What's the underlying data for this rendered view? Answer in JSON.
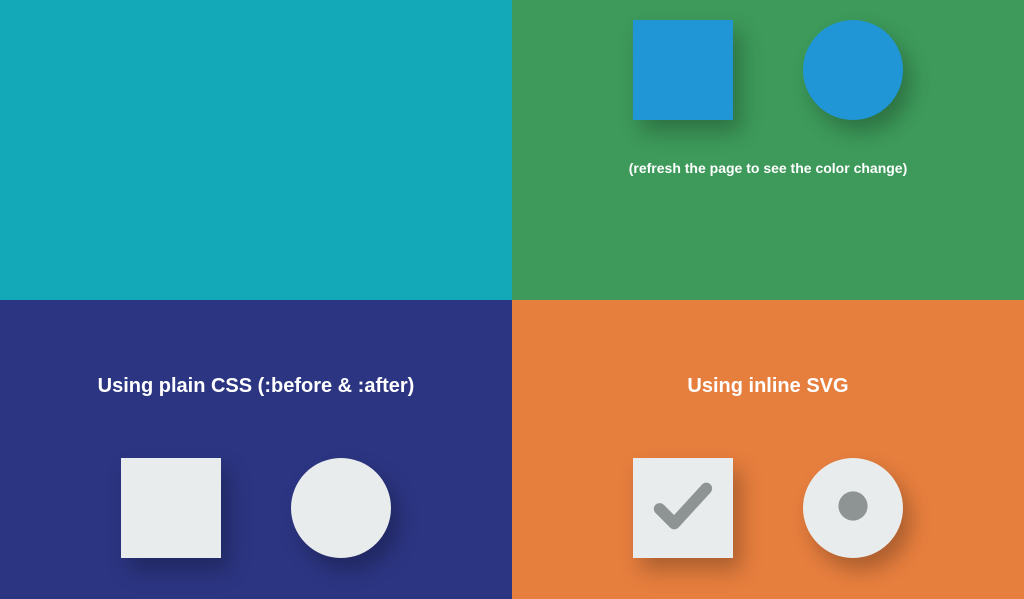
{
  "panels": {
    "topRight": {
      "hint": "(refresh the page to see the color change)"
    },
    "bottomLeft": {
      "heading": "Using plain CSS (:before & :after)"
    },
    "bottomRight": {
      "heading": "Using inline SVG"
    }
  },
  "colors": {
    "teal": "#14a9b8",
    "green": "#3d9a5a",
    "navy": "#2c3582",
    "orange": "#e67e3e",
    "shapeBlue": "#2196d6",
    "shapeLight": "#e8ecec",
    "iconGray": "#8e9494"
  }
}
